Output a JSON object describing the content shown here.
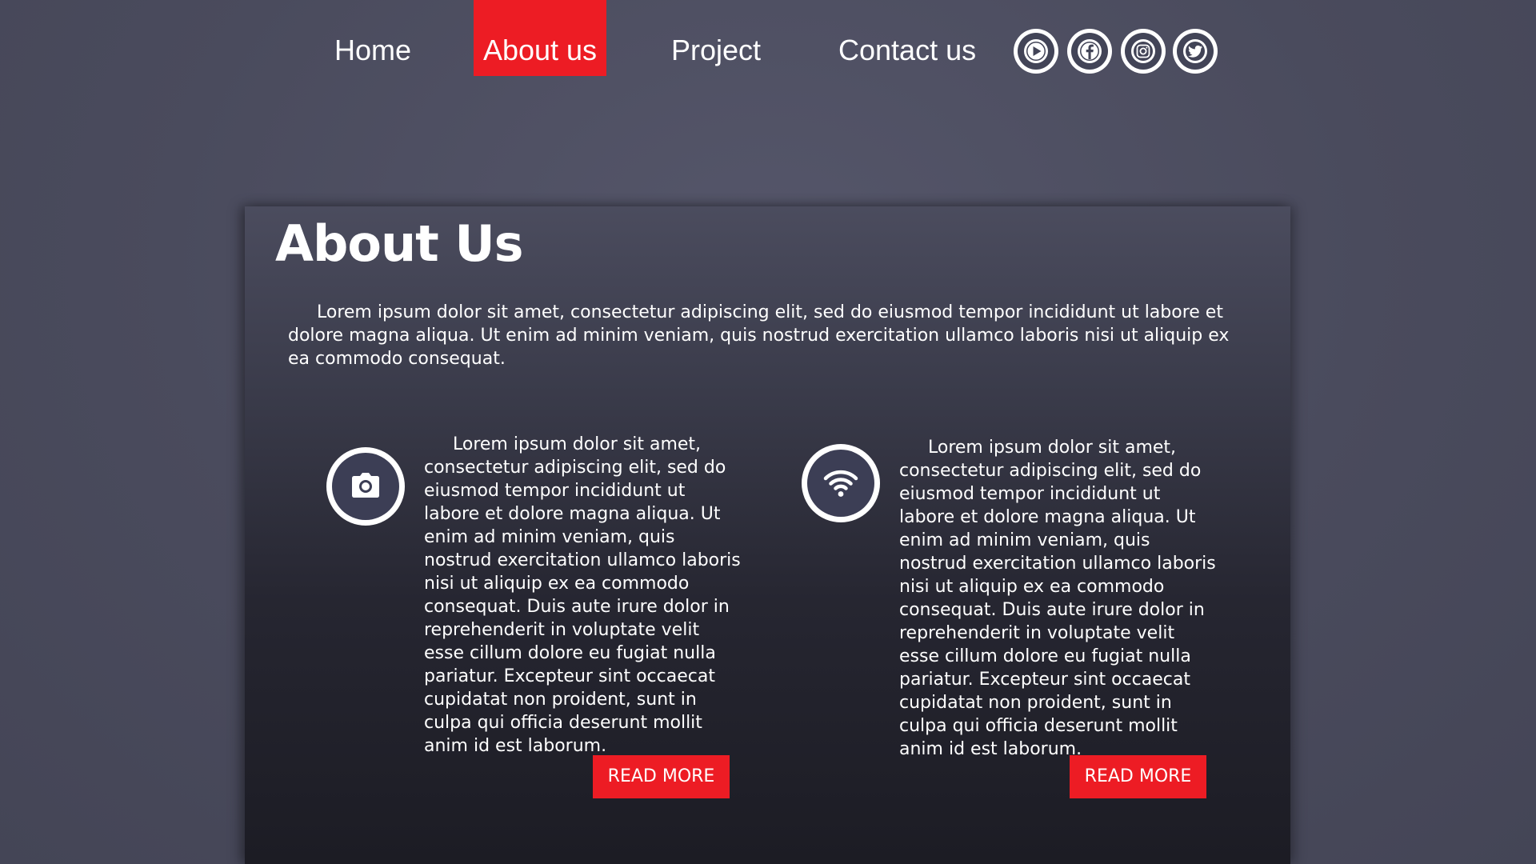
{
  "nav": {
    "items": [
      {
        "label": "Home",
        "active": false
      },
      {
        "label": "About us",
        "active": true
      },
      {
        "label": "Project",
        "active": false
      },
      {
        "label": "Contact us",
        "active": false
      }
    ],
    "social": [
      {
        "icon": "youtube-icon"
      },
      {
        "icon": "facebook-icon"
      },
      {
        "icon": "instagram-icon"
      },
      {
        "icon": "twitter-icon"
      }
    ]
  },
  "about": {
    "title": "About Us",
    "intro": "Lorem ipsum dolor sit amet, consectetur adipiscing elit, sed do eiusmod tempor incididunt ut labore et dolore magna aliqua. Ut enim ad minim veniam, quis nostrud exercitation ullamco laboris nisi ut aliquip ex ea commodo consequat.",
    "features": [
      {
        "icon": "camera-icon",
        "text": "Lorem ipsum dolor sit amet, con­sectetur adipiscing elit, sed do eius­mod tempor incididunt ut labore et dolore magna aliqua. Ut enim ad minim veniam, quis nostrud exer­citation ullamco laboris nisi ut ali­quip ex ea commodo consequat. Duis aute irure dolor in reprehen­derit in voluptate velit esse cillum dolore eu fugiat nulla pariatur. Ex­cepteur sint occaecat cupidatat non proident, sunt in culpa qui officia deserunt mollit anim id est laborum.",
        "button": "READ MORE"
      },
      {
        "icon": "wifi-icon",
        "text": "Lorem ipsum dolor sit amet, con­sectetur adipiscing elit, sed do eius­mod tempor incididunt ut labore et dolore magna aliqua. Ut enim ad minim veniam, quis nostrud exer­citation ullamco laboris nisi ut ali­quip ex ea commodo consequat. Duis aute irure dolor in reprehen­derit in voluptate velit esse cillum dolore eu fugiat nulla pariatur. Ex­cepteur sint occaecat cupidatat non proident, sunt in culpa qui officia deserunt mollit anim id est laborum.",
        "button": "READ MORE"
      }
    ]
  },
  "colors": {
    "accent": "#ed1c24",
    "background": "#4b4c5e",
    "icon_fill": "#3c3e55"
  }
}
